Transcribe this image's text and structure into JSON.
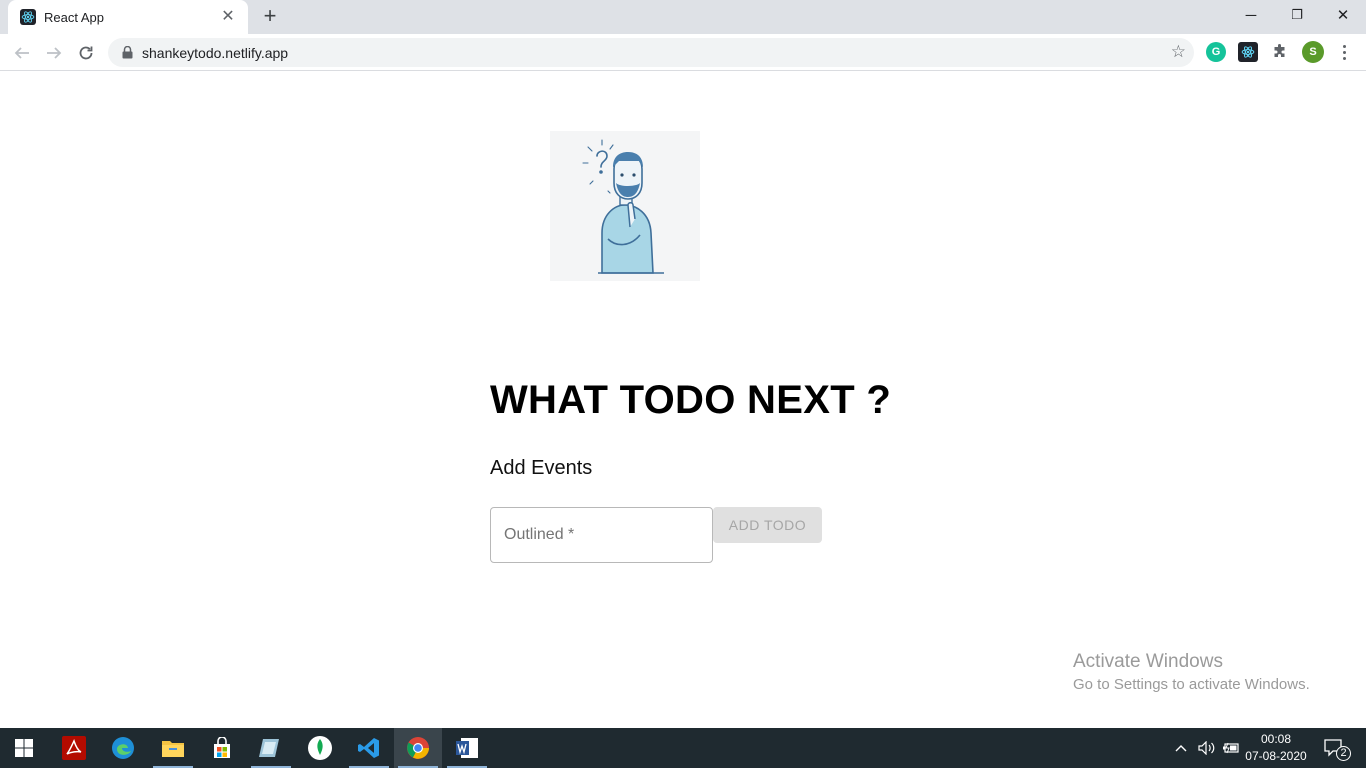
{
  "browser": {
    "tab_title": "React App",
    "tab_close": "✕",
    "new_tab": "+",
    "url": "shankeytodo.netlify.app",
    "window_minimize": "─",
    "window_restore": "❐",
    "window_close": "✕",
    "profile_initial": "S",
    "grammarly_initial": "G"
  },
  "app": {
    "heading": "WHAT TODO NEXT ?",
    "subheading": "Add Events",
    "input_label": "Outlined *",
    "add_button": "ADD TODO"
  },
  "watermark": {
    "line1": "Activate Windows",
    "line2": "Go to Settings to activate Windows."
  },
  "taskbar": {
    "time": "00:08",
    "date": "07-08-2020",
    "notification_count": "2"
  },
  "colors": {
    "tabbar": "#dee1e6",
    "taskbar": "#1f2a30",
    "button_disabled": "#e0e0e0"
  }
}
